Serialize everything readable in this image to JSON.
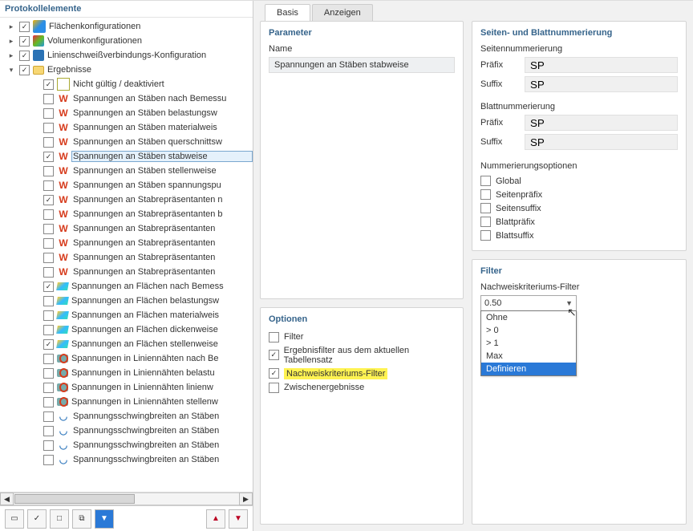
{
  "left": {
    "title": "Protokollelemente",
    "root": [
      {
        "label": "Flächenkonfigurationen",
        "checked": true,
        "expander": "▸",
        "icon": "ic-surf"
      },
      {
        "label": "Volumenkonfigurationen",
        "checked": true,
        "expander": "▸",
        "icon": "ic-vol"
      },
      {
        "label": "Linienschweißverbindungs-Konfiguration",
        "checked": true,
        "expander": "▸",
        "icon": "ic-weld"
      },
      {
        "label": "Ergebnisse",
        "checked": true,
        "expander": "▾",
        "icon": "ic-folder"
      }
    ],
    "children": [
      {
        "label": "Nicht gültig / deaktiviert",
        "checked": true,
        "icon": "ic-invalid"
      },
      {
        "label": "Spannungen an Stäben nach Bemessu",
        "checked": false,
        "icon": "ic-beam"
      },
      {
        "label": "Spannungen an Stäben belastungsw",
        "checked": false,
        "icon": "ic-beam"
      },
      {
        "label": "Spannungen an Stäben materialweis",
        "checked": false,
        "icon": "ic-beam"
      },
      {
        "label": "Spannungen an Stäben querschnittsw",
        "checked": false,
        "icon": "ic-beam"
      },
      {
        "label": "Spannungen an Stäben stabweise",
        "checked": true,
        "icon": "ic-beam",
        "selected": true
      },
      {
        "label": "Spannungen an Stäben stellenweise",
        "checked": false,
        "icon": "ic-beam"
      },
      {
        "label": "Spannungen an Stäben spannungspu",
        "checked": false,
        "icon": "ic-beam"
      },
      {
        "label": "Spannungen an Stabrepräsentanten n",
        "checked": true,
        "icon": "ic-beam"
      },
      {
        "label": "Spannungen an Stabrepräsentanten b",
        "checked": false,
        "icon": "ic-beam"
      },
      {
        "label": "Spannungen an Stabrepräsentanten",
        "checked": false,
        "icon": "ic-beam"
      },
      {
        "label": "Spannungen an Stabrepräsentanten",
        "checked": false,
        "icon": "ic-beam"
      },
      {
        "label": "Spannungen an Stabrepräsentanten",
        "checked": false,
        "icon": "ic-beam"
      },
      {
        "label": "Spannungen an Stabrepräsentanten",
        "checked": false,
        "icon": "ic-beam"
      },
      {
        "label": "Spannungen an Flächen nach Bemess",
        "checked": true,
        "icon": "ic-area"
      },
      {
        "label": "Spannungen an Flächen belastungsw",
        "checked": false,
        "icon": "ic-area"
      },
      {
        "label": "Spannungen an Flächen materialweis",
        "checked": false,
        "icon": "ic-area"
      },
      {
        "label": "Spannungen an Flächen dickenweise",
        "checked": false,
        "icon": "ic-area"
      },
      {
        "label": "Spannungen an Flächen stellenweise",
        "checked": true,
        "icon": "ic-area"
      },
      {
        "label": "Spannungen in Liniennähten nach Be",
        "checked": false,
        "icon": "ic-line"
      },
      {
        "label": "Spannungen in Liniennähten belastu",
        "checked": false,
        "icon": "ic-line"
      },
      {
        "label": "Spannungen in Liniennähten linienw",
        "checked": false,
        "icon": "ic-line"
      },
      {
        "label": "Spannungen in Liniennähten stellenw",
        "checked": false,
        "icon": "ic-line"
      },
      {
        "label": "Spannungsschwingbreiten an Stäben",
        "checked": false,
        "icon": "ic-swing"
      },
      {
        "label": "Spannungsschwingbreiten an Stäben",
        "checked": false,
        "icon": "ic-swing"
      },
      {
        "label": "Spannungsschwingbreiten an Stäben",
        "checked": false,
        "icon": "ic-swing"
      },
      {
        "label": "Spannungsschwingbreiten an Stäben",
        "checked": false,
        "icon": "ic-swing"
      }
    ]
  },
  "tabs": {
    "basis": "Basis",
    "anzeigen": "Anzeigen"
  },
  "parameter": {
    "title": "Parameter",
    "name_label": "Name",
    "name_value": "Spannungen an Stäben stabweise"
  },
  "numbering": {
    "title": "Seiten- und Blattnummerierung",
    "page_heading": "Seitennummerierung",
    "prefix_label": "Präfix",
    "suffix_label": "Suffix",
    "page_prefix": "SP",
    "page_suffix": "SP",
    "sheet_heading": "Blattnummerierung",
    "sheet_prefix": "SP",
    "sheet_suffix": "SP",
    "opts_heading": "Nummerierungsoptionen",
    "opts": [
      "Global",
      "Seitenpräfix",
      "Seitensuffix",
      "Blattpräfix",
      "Blattsuffix"
    ]
  },
  "options": {
    "title": "Optionen",
    "items": [
      {
        "label": "Filter",
        "checked": false,
        "hl": false
      },
      {
        "label": "Ergebnisfilter aus dem aktuellen Tabellensatz",
        "checked": true,
        "hl": false
      },
      {
        "label": "Nachweiskriteriums-Filter",
        "checked": true,
        "hl": true
      },
      {
        "label": "Zwischenergebnisse",
        "checked": false,
        "hl": false
      }
    ]
  },
  "filter": {
    "title": "Filter",
    "label": "Nachweiskriteriums-Filter",
    "value": "0.50",
    "opts": [
      "Ohne",
      "> 0",
      "> 1",
      "Max",
      "Definieren"
    ]
  }
}
